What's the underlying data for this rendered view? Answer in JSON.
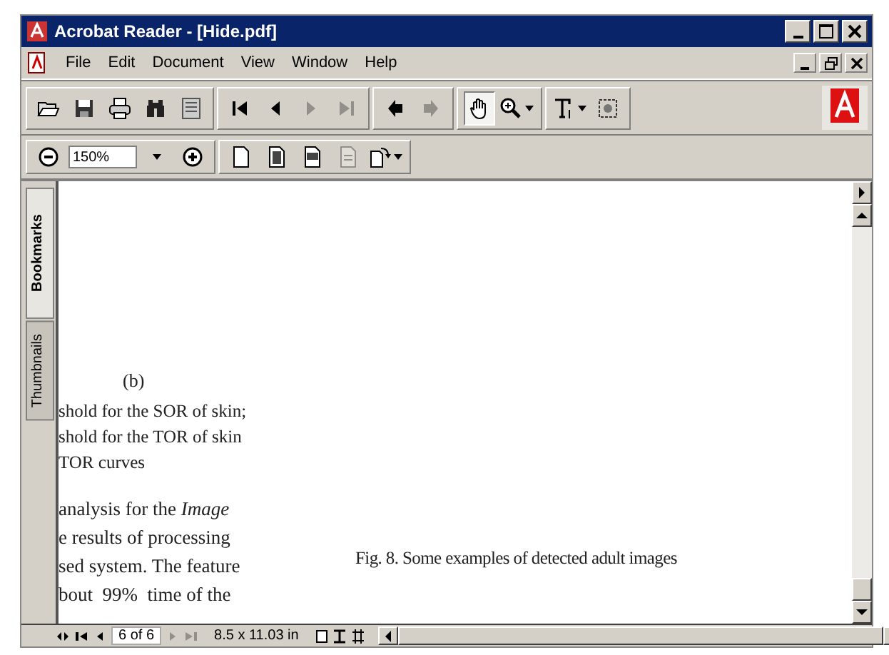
{
  "window": {
    "title": "Acrobat Reader - [Hide.pdf]"
  },
  "menu": [
    "File",
    "Edit",
    "Document",
    "View",
    "Window",
    "Help"
  ],
  "toolbar": [
    {
      "disabled": false,
      "selected": false
    },
    {
      "disabled": false,
      "selected": false
    },
    {
      "disabled": false,
      "selected": false
    },
    {
      "disabled": false,
      "selected": false
    },
    {
      "disabled": false,
      "selected": false
    },
    {
      "disabled": false,
      "selected": false
    },
    {
      "disabled": false,
      "selected": false
    },
    {
      "disabled": true,
      "selected": false
    },
    {
      "disabled": true,
      "selected": false
    },
    {
      "disabled": false,
      "selected": false
    },
    {
      "disabled": true,
      "selected": false
    },
    {
      "disabled": false,
      "selected": true
    },
    {
      "disabled": false,
      "selected": false
    },
    {
      "disabled": false,
      "selected": false
    },
    {
      "disabled": false,
      "selected": false
    }
  ],
  "zoom": {
    "value": "150%"
  },
  "view_buttons": [
    {
      "disabled": false
    },
    {
      "disabled": false
    },
    {
      "disabled": false
    },
    {
      "disabled": true
    },
    {
      "disabled": false
    }
  ],
  "side_tabs": [
    {
      "label": "Bookmarks",
      "selected": true
    },
    {
      "label": "Thumbnails",
      "selected": false
    }
  ],
  "document": {
    "subfigure_label": "(b)",
    "legend_lines": [
      "shold for the SOR of skin;",
      "shold for the TOR of skin",
      "TOR curves"
    ],
    "body_lines": [
      "analysis for the *Image*",
      "e results of processing",
      "sed system. The feature",
      "bout  99%  time of the"
    ],
    "caption": "Fig. 8. Some examples of detected adult images"
  },
  "status_bar": {
    "page": "6 of 6",
    "page_size": "8.5 x 11.03 in",
    "nav": [
      {
        "disabled": false
      },
      {
        "disabled": false
      },
      {
        "disabled": true
      },
      {
        "disabled": true
      }
    ]
  }
}
